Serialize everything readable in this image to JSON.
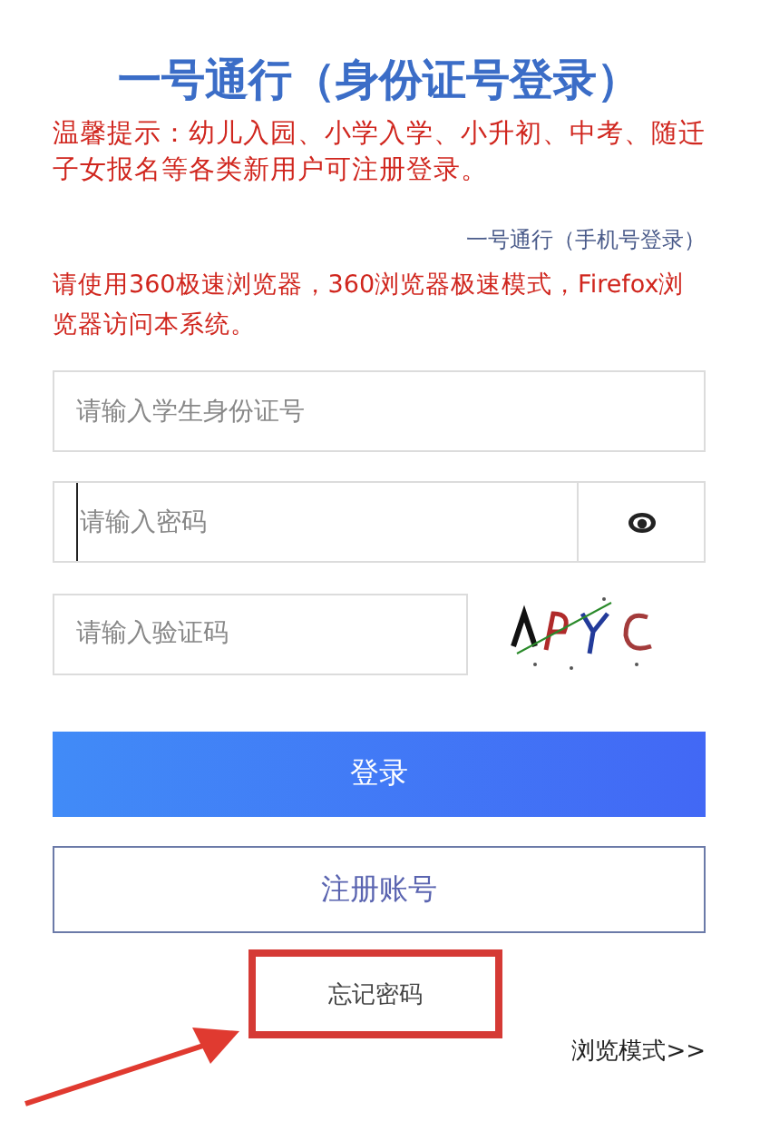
{
  "title": "一号通行（身份证号登录）",
  "tip": "温馨提示：幼儿入园、小学入学、小升初、中考、随迁子女报名等各类新用户可注册登录。",
  "phone_login_link": "一号通行（手机号登录）",
  "browser_notice": "请使用360极速浏览器，360浏览器极速模式，Firefox浏览器访问本系统。",
  "fields": [
    {
      "kind": "text",
      "placeholder": "请输入学生身份证号"
    },
    {
      "kind": "password",
      "placeholder": "请输入密码",
      "focused": true
    },
    {
      "kind": "captcha",
      "placeholder": "请输入验证码"
    }
  ],
  "login_button": "登录",
  "register_button": "注册账号",
  "forgot_password": {
    "label": "忘记密码",
    "highlighted": true
  },
  "browse_mode_link": "浏览模式>>"
}
